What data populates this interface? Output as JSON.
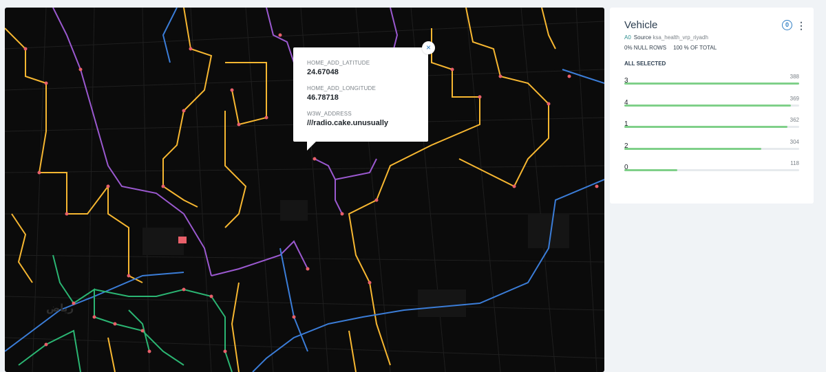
{
  "popup": {
    "fields": [
      {
        "key": "HOME_ADD_LATITUDE",
        "value": "24.67048"
      },
      {
        "key": "HOME_ADD_LONGITUDE",
        "value": "46.78718"
      },
      {
        "key": "W3W_ADDRESS",
        "value": "///radio.cake.unusually"
      }
    ],
    "close_glyph": "×"
  },
  "map": {
    "label": "رياض",
    "route_colors": {
      "yellow": "#f7b731",
      "purple": "#9b59d0",
      "blue": "#3b7dd8",
      "green": "#2bb673",
      "stop": "#e8606a"
    }
  },
  "panel": {
    "title": "Vehicle",
    "source_tag": "A0",
    "source_label": "Source",
    "source_value": "ksa_health_vrp_riyadh",
    "null_rows": "0% NULL ROWS",
    "of_total": "100 % OF TOTAL",
    "selection": "ALL SELECTED",
    "pin_glyph": "0",
    "menu_glyph": "⋮",
    "max": 388,
    "categories": [
      {
        "label": "3",
        "count": 388
      },
      {
        "label": "4",
        "count": 369
      },
      {
        "label": "1",
        "count": 362
      },
      {
        "label": "2",
        "count": 304
      },
      {
        "label": "0",
        "count": 118
      }
    ]
  }
}
